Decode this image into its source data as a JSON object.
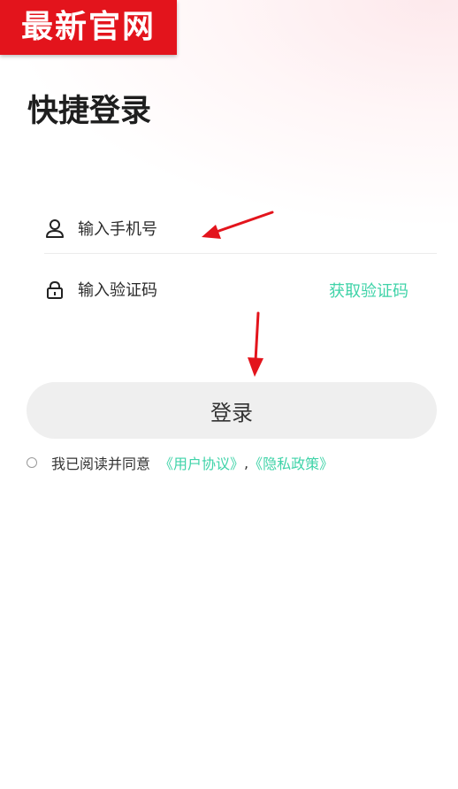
{
  "watermark": {
    "text": "最新官网"
  },
  "page": {
    "title": "快捷登录"
  },
  "phone_field": {
    "placeholder": "输入手机号",
    "value": ""
  },
  "code_field": {
    "placeholder": "输入验证码",
    "value": ""
  },
  "get_code": {
    "label": "获取验证码"
  },
  "login": {
    "label": "登录"
  },
  "agreement": {
    "prefix": "我已阅读并同意",
    "user_agreement": "《用户协议》",
    "separator": ",",
    "privacy_policy": "《隐私政策》",
    "checked": false
  },
  "icons": {
    "phone_field": "user-icon",
    "code_field": "lock-icon",
    "annotation": "red-arrow-icon"
  },
  "colors": {
    "accent": "#3fd3a8",
    "watermark_bg": "#e3141c",
    "button_bg": "#efefef",
    "arrow": "#e3141c"
  }
}
